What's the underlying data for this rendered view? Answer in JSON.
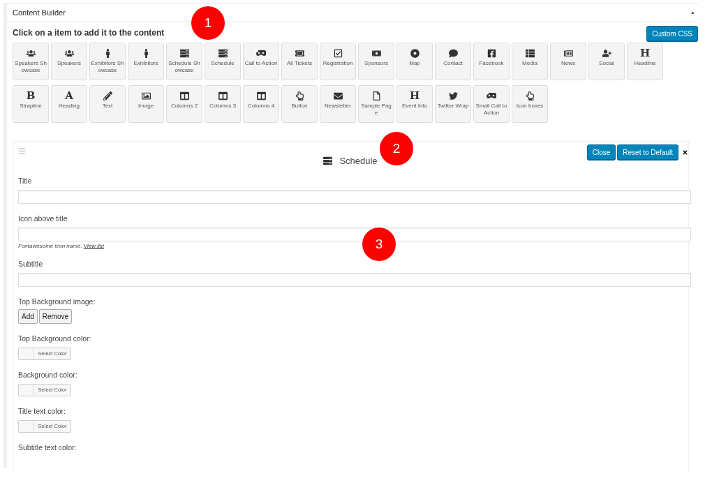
{
  "panel": {
    "title": "Content Builder",
    "collapse_glyph": "▲"
  },
  "builder": {
    "heading": "Click on a item to add it to the content",
    "custom_css_button": "Custom CSS",
    "rows": [
      [
        {
          "kind": "icon",
          "label": "Speakers Showcase"
        },
        {
          "kind": "icon",
          "label": "Speakers"
        },
        {
          "kind": "icon",
          "label": "Exhibitors Showcase"
        },
        {
          "kind": "icon",
          "label": "Exhibitors"
        },
        {
          "kind": "icon",
          "label": "Schedule Showcase"
        },
        {
          "kind": "icon",
          "label": "Schedule"
        },
        {
          "kind": "icon",
          "label": "Call to Action"
        },
        {
          "kind": "icon",
          "label": "All Tickets"
        },
        {
          "kind": "icon",
          "label": "Registration"
        },
        {
          "kind": "icon",
          "label": "Sponsors"
        },
        {
          "kind": "icon",
          "label": "Map"
        },
        {
          "kind": "icon",
          "label": "Contact"
        },
        {
          "kind": "icon",
          "label": "Facebook"
        },
        {
          "kind": "icon",
          "label": "Media"
        },
        {
          "kind": "icon",
          "label": "News"
        },
        {
          "kind": "icon",
          "label": "Social"
        },
        {
          "kind": "glyph",
          "glyph": "H",
          "label": "Headline"
        }
      ],
      [
        {
          "kind": "glyph",
          "glyph": "B",
          "label": "Strapline"
        },
        {
          "kind": "glyph",
          "glyph": "A",
          "label": "Heading"
        },
        {
          "kind": "icon",
          "label": "Text"
        },
        {
          "kind": "icon",
          "label": "Image"
        },
        {
          "kind": "icon",
          "label": "Columns 2"
        },
        {
          "kind": "icon",
          "label": "Columns 3"
        },
        {
          "kind": "icon",
          "label": "Columns 4"
        },
        {
          "kind": "icon",
          "label": "Button"
        },
        {
          "kind": "icon",
          "label": "Newsletter"
        },
        {
          "kind": "icon",
          "label": "Sample Page"
        },
        {
          "kind": "glyph",
          "glyph": "H",
          "label": "Event Info"
        },
        {
          "kind": "icon",
          "label": "Twitter Wrap"
        },
        {
          "kind": "icon",
          "label": "Small Call to Action"
        },
        {
          "kind": "icon",
          "label": "Icon boxes"
        }
      ]
    ]
  },
  "editor": {
    "title": "Schedule",
    "buttons": [
      "Close",
      "Reset to Default"
    ],
    "fields": [
      {
        "kind": "text",
        "label": "Title"
      },
      {
        "kind": "text",
        "label": "Icon above title",
        "help": "Fontawesome icon name.",
        "help_link": "View list"
      },
      {
        "kind": "text",
        "label": "Subtitle"
      },
      {
        "kind": "media",
        "label": "Top Background image:",
        "buttons": [
          "Add",
          "Remove"
        ]
      },
      {
        "kind": "color",
        "label": "Top Background color:",
        "button": "Select Color"
      },
      {
        "kind": "color",
        "label": "Background color:",
        "button": "Select Color"
      },
      {
        "kind": "color",
        "label": "Title text color:",
        "button": "Select Color"
      },
      {
        "kind": "label",
        "label": "Subtitle text color:"
      }
    ]
  },
  "annotations": [
    "1",
    "2",
    "3"
  ]
}
